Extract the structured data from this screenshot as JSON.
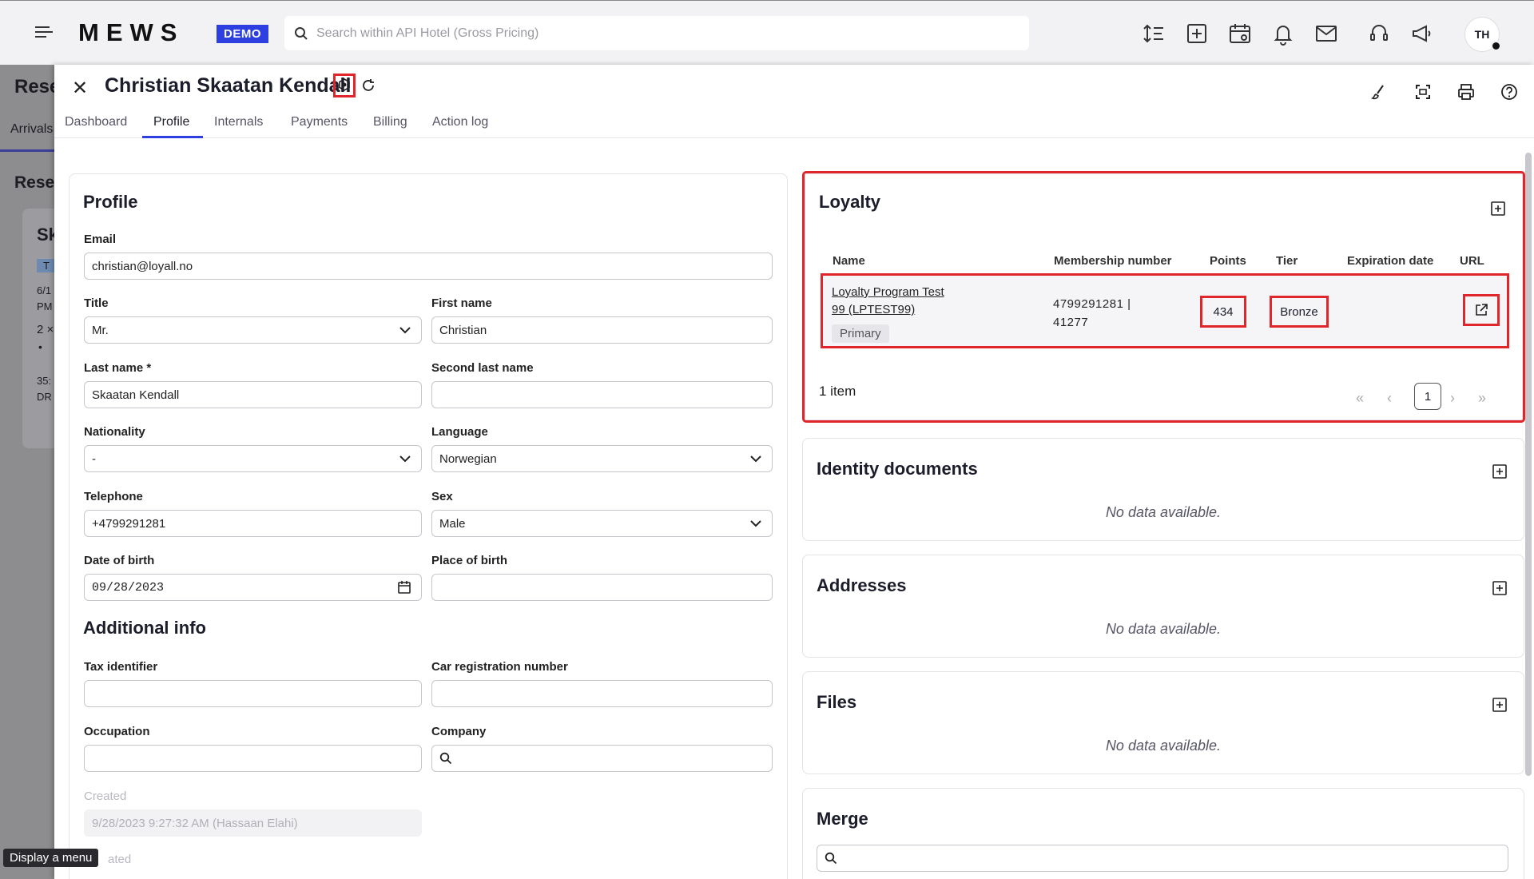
{
  "topbar": {
    "logo": "MEWS",
    "demo_badge": "DEMO",
    "search_placeholder": "Search within API Hotel (Gross Pricing)",
    "user_initials": "TH"
  },
  "background": {
    "title_fragment": "Rese",
    "tab_fragment": "Arrivals",
    "subtitle_fragment": "Rese",
    "card_title_fragment": "Sk",
    "badge_fragment": "T",
    "date_fragment": "6/1",
    "time_fragment": "PM",
    "count_fragment": "2 ×",
    "bullet": "•",
    "num_fragment": "35:",
    "code_fragment": "DR"
  },
  "drawer": {
    "guest_name": "Christian Skaatan Kendall",
    "tabs": [
      {
        "label": "Dashboard"
      },
      {
        "label": "Profile"
      },
      {
        "label": "Internals"
      },
      {
        "label": "Payments"
      },
      {
        "label": "Billing"
      },
      {
        "label": "Action log"
      }
    ],
    "active_tab": "Profile"
  },
  "profile": {
    "title": "Profile",
    "email_label": "Email",
    "email": "christian@loyall.no",
    "title_label": "Title",
    "title_value": "Mr.",
    "first_name_label": "First name",
    "first_name": "Christian",
    "last_name_label": "Last name *",
    "last_name": "Skaatan Kendall",
    "second_last_name_label": "Second last name",
    "second_last_name": "",
    "nationality_label": "Nationality",
    "nationality": "-",
    "language_label": "Language",
    "language": "Norwegian",
    "telephone_label": "Telephone",
    "telephone": "+4799291281",
    "sex_label": "Sex",
    "sex": "Male",
    "dob_label": "Date of birth",
    "dob": "09/28/2023",
    "pob_label": "Place of birth",
    "pob": "",
    "additional_title": "Additional info",
    "tax_label": "Tax identifier",
    "car_label": "Car registration number",
    "occupation_label": "Occupation",
    "company_label": "Company",
    "created_label": "Created",
    "created_value": "9/28/2023 9:27:32 AM (Hassaan Elahi)",
    "updated_fragment": "ated"
  },
  "loyalty": {
    "title": "Loyalty",
    "columns": [
      "Name",
      "Membership number",
      "Points",
      "Tier",
      "Expiration date",
      "URL"
    ],
    "rows": [
      {
        "name_line1": "Loyalty Program Test",
        "name_line2": "99 (LPTEST99)",
        "badge": "Primary",
        "membership_line1": "4799291281 |",
        "membership_line2": "41277",
        "points": "434",
        "tier": "Bronze",
        "expiration": ""
      }
    ],
    "count_text": "1 item",
    "current_page": "1"
  },
  "identity": {
    "title": "Identity documents",
    "empty": "No data available."
  },
  "addresses": {
    "title": "Addresses",
    "empty": "No data available."
  },
  "files": {
    "title": "Files",
    "empty": "No data available."
  },
  "merge": {
    "title": "Merge"
  },
  "tooltip": "Display a menu",
  "colors": {
    "accent": "#2d3fe0",
    "highlight": "#e0262b"
  }
}
